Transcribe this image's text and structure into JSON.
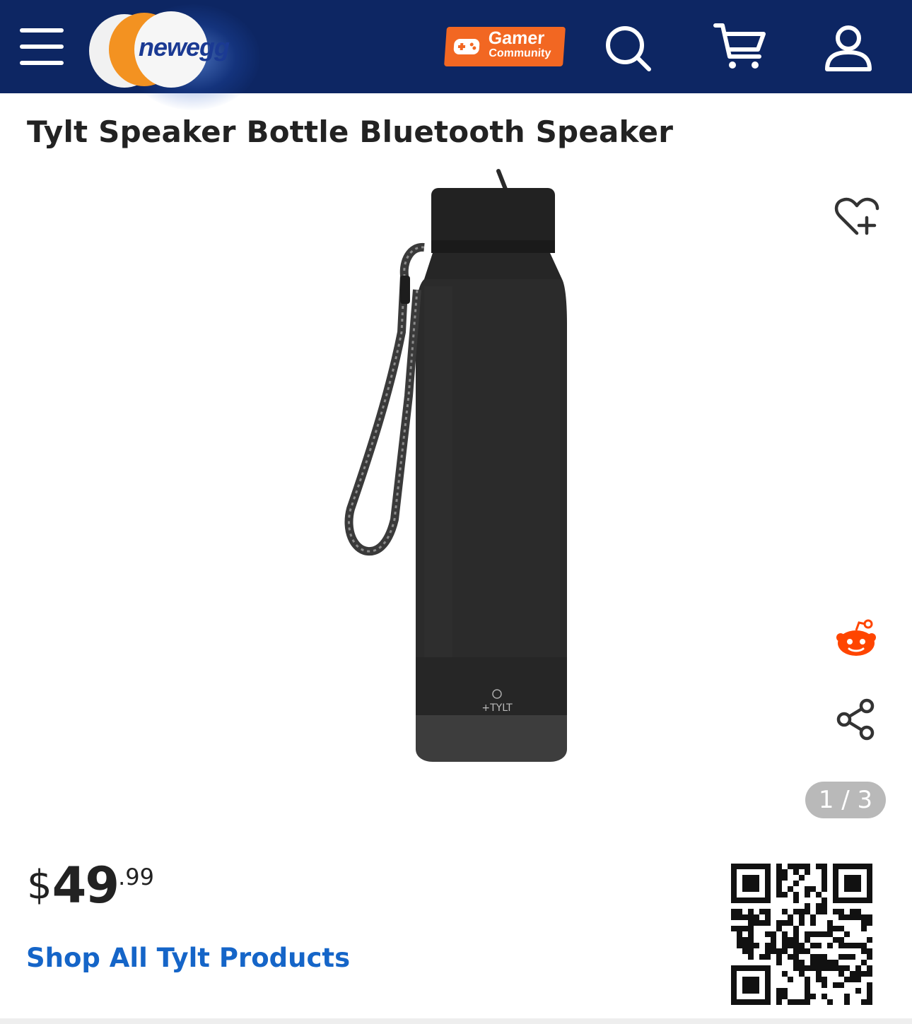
{
  "header": {
    "logo_text": "newegg",
    "gamer_badge": {
      "line1": "Gamer",
      "line2": "Community"
    },
    "icons": [
      "menu-icon",
      "search-icon",
      "cart-icon",
      "account-icon"
    ],
    "background_color": "#0d2663",
    "badge_color": "#f26722"
  },
  "product": {
    "title": "Tylt Speaker Bottle Bluetooth Speaker",
    "image_alt_brand": "+TYLT",
    "gallery_counter": "1 / 3"
  },
  "side_actions": {
    "icons": [
      "wishlist-add-icon",
      "reddit-icon",
      "share-icon"
    ],
    "reddit_color": "#ff4500"
  },
  "price": {
    "currency": "$",
    "dollars": "49",
    "cents": ".99"
  },
  "shop_all_link": "Shop All Tylt Products",
  "link_color": "#1565c8"
}
